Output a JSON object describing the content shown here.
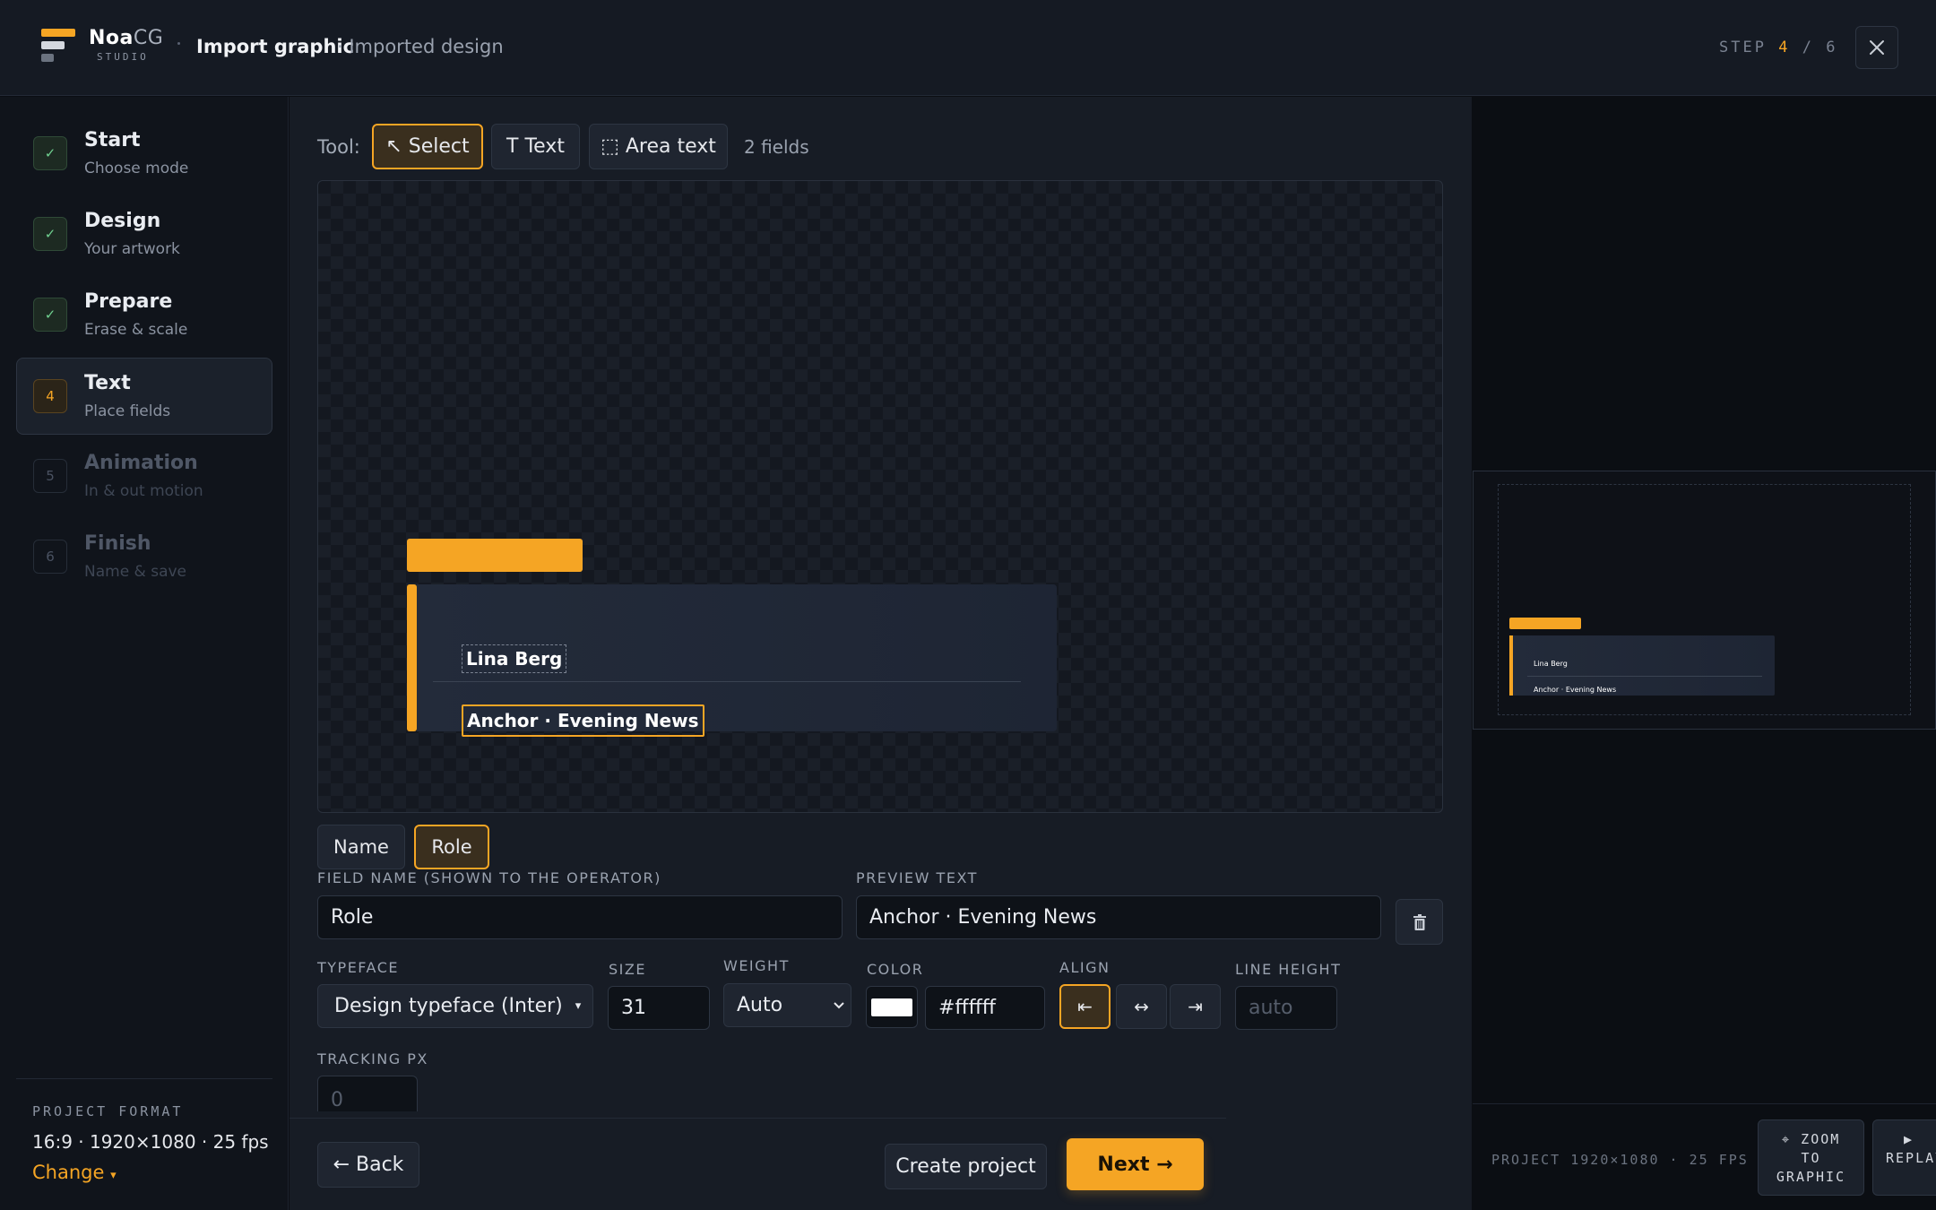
{
  "app": {
    "brand_bold": "Noa",
    "brand_light": "CG",
    "brand_sub": "STUDIO",
    "title": "Import graphic",
    "subtitle": "· Imported design"
  },
  "step_indicator": {
    "label": "STEP",
    "current": "4",
    "sep": "/",
    "total": "6"
  },
  "sidebar": {
    "steps": [
      {
        "badge": "✓",
        "title": "Start",
        "sub": "Choose mode",
        "state": "done"
      },
      {
        "badge": "✓",
        "title": "Design",
        "sub": "Your artwork",
        "state": "done"
      },
      {
        "badge": "✓",
        "title": "Prepare",
        "sub": "Erase & scale",
        "state": "done"
      },
      {
        "badge": "4",
        "title": "Text",
        "sub": "Place fields",
        "state": "current"
      },
      {
        "badge": "5",
        "title": "Animation",
        "sub": "In & out motion",
        "state": "todo"
      },
      {
        "badge": "6",
        "title": "Finish",
        "sub": "Name & save",
        "state": "todo"
      }
    ],
    "project_format_label": "PROJECT FORMAT",
    "project_format_value": "16:9 · 1920×1080 · 25 fps",
    "change_label": "Change"
  },
  "toolbar": {
    "label": "Tool:",
    "select": "↖ Select",
    "text": "T Text",
    "area_text": "⬚ Area text",
    "fields_count": "2 fields"
  },
  "canvas": {
    "name_field": "Lina Berg",
    "role_field": "Anchor · Evening News"
  },
  "field_tabs": [
    "Name",
    "Role"
  ],
  "editor": {
    "field_name_label": "FIELD NAME (SHOWN TO THE OPERATOR)",
    "field_name_value": "Role",
    "preview_label": "PREVIEW TEXT",
    "preview_value": "Anchor · Evening News",
    "typeface_label": "TYPEFACE",
    "typeface_value": "Design typeface (Inter)",
    "size_label": "SIZE",
    "size_value": "31",
    "weight_label": "WEIGHT",
    "weight_value": "Auto",
    "color_label": "COLOR",
    "color_value": "#ffffff",
    "align_label": "ALIGN",
    "align_left": "⇤",
    "align_center": "↔",
    "align_right": "⇥",
    "line_height_label": "LINE HEIGHT",
    "line_height_placeholder": "auto",
    "tracking_label": "TRACKING PX",
    "tracking_placeholder": "0"
  },
  "footer": {
    "back": "← Back",
    "create": "Create project",
    "next": "Next →"
  },
  "preview": {
    "name": "Lina Berg",
    "role": "Anchor · Evening News",
    "info": "PROJECT 1920×1080 · 25 FPS",
    "zoom_line1": "⌖ ZOOM",
    "zoom_line2": "TO",
    "zoom_line3": "GRAPHIC",
    "replay_line1": "▶",
    "replay_line2": "REPLAY"
  },
  "colors": {
    "accent": "#f5a524",
    "done": "#6fcf8f"
  }
}
